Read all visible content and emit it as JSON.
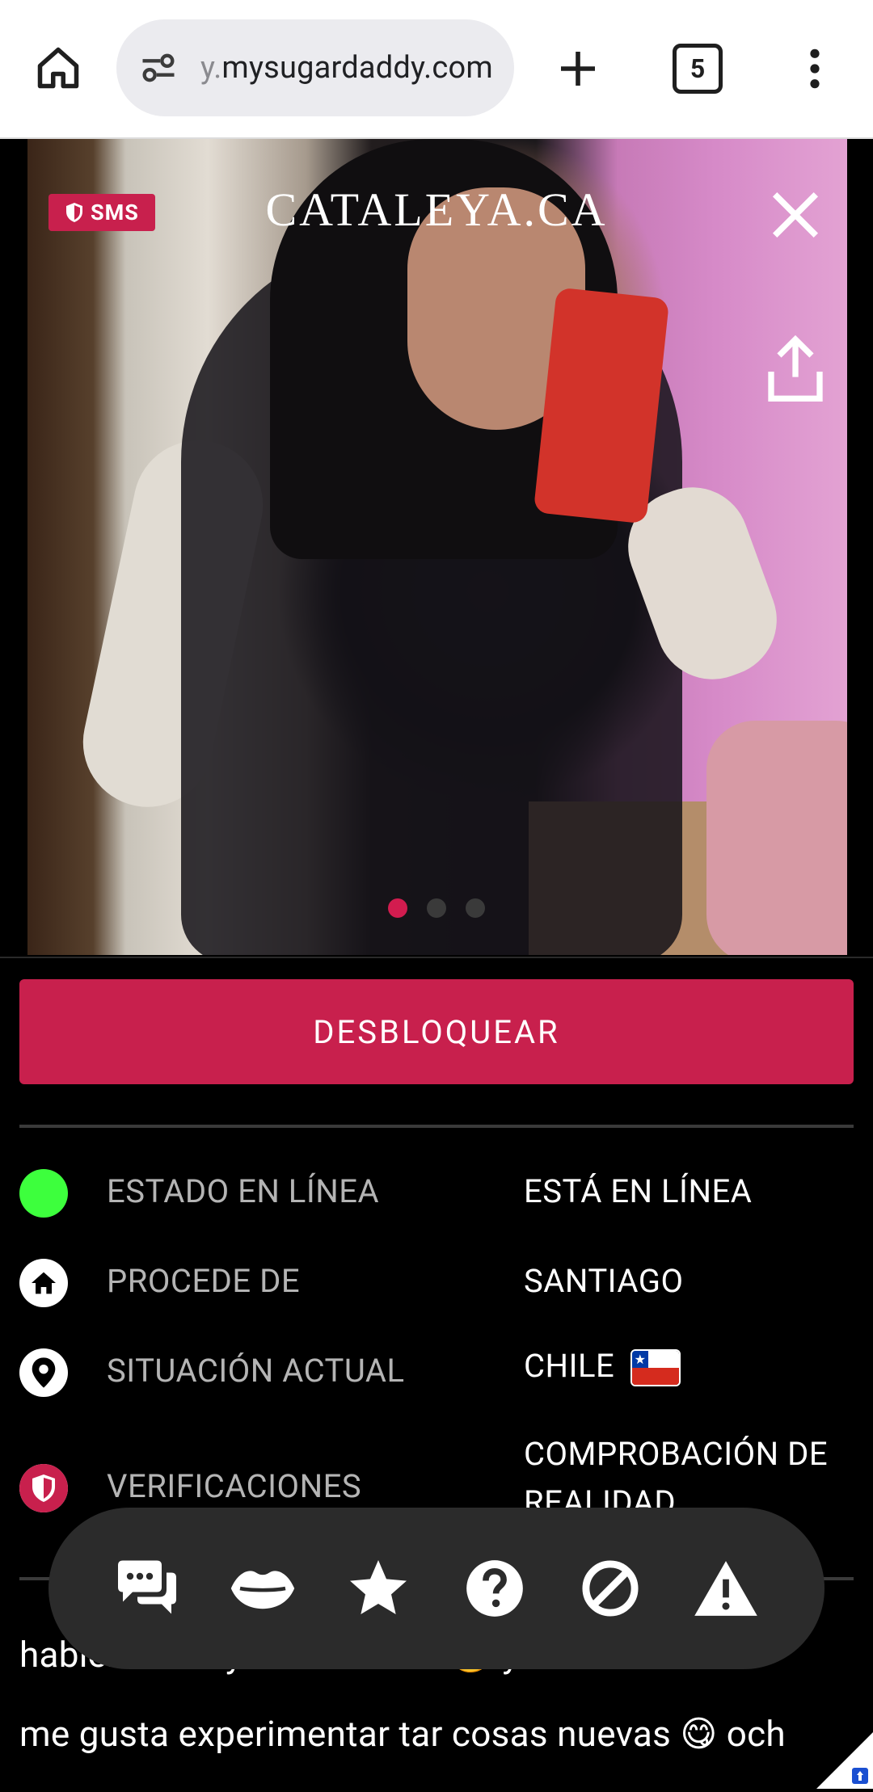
{
  "browser": {
    "url_prefix": "y.",
    "url_main": "mysugardaddy.com",
    "tab_count": "5"
  },
  "profile": {
    "badge": "SMS",
    "name": "CATALEYA.CA",
    "photo_count": 3,
    "active_photo": 1
  },
  "unlock_label": "DESBLOQUEAR",
  "info": {
    "status_label": "ESTADO EN LÍNEA",
    "status_value": "ESTÁ EN LÍNEA",
    "origin_label": "PROCEDE DE",
    "origin_value": "SANTIAGO",
    "location_label": "SITUACIÓN ACTUAL",
    "location_value": "CHILE",
    "verify_label": "VERIFICACIONES",
    "verify_value_line1": "COMPROBACIÓN DE",
    "verify_value_line2": "REALIDAD"
  },
  "bio": {
    "line1": "hablemos soy buena onda 🙂 y de discreto",
    "line2": "me gusta experimentar tar cosas nuevas 😋 och"
  },
  "actions": [
    "chat-icon",
    "kiss-icon",
    "star-icon",
    "question-icon",
    "block-icon",
    "warning-icon"
  ],
  "colors": {
    "accent": "#c8204d",
    "online": "#3dff3d"
  }
}
